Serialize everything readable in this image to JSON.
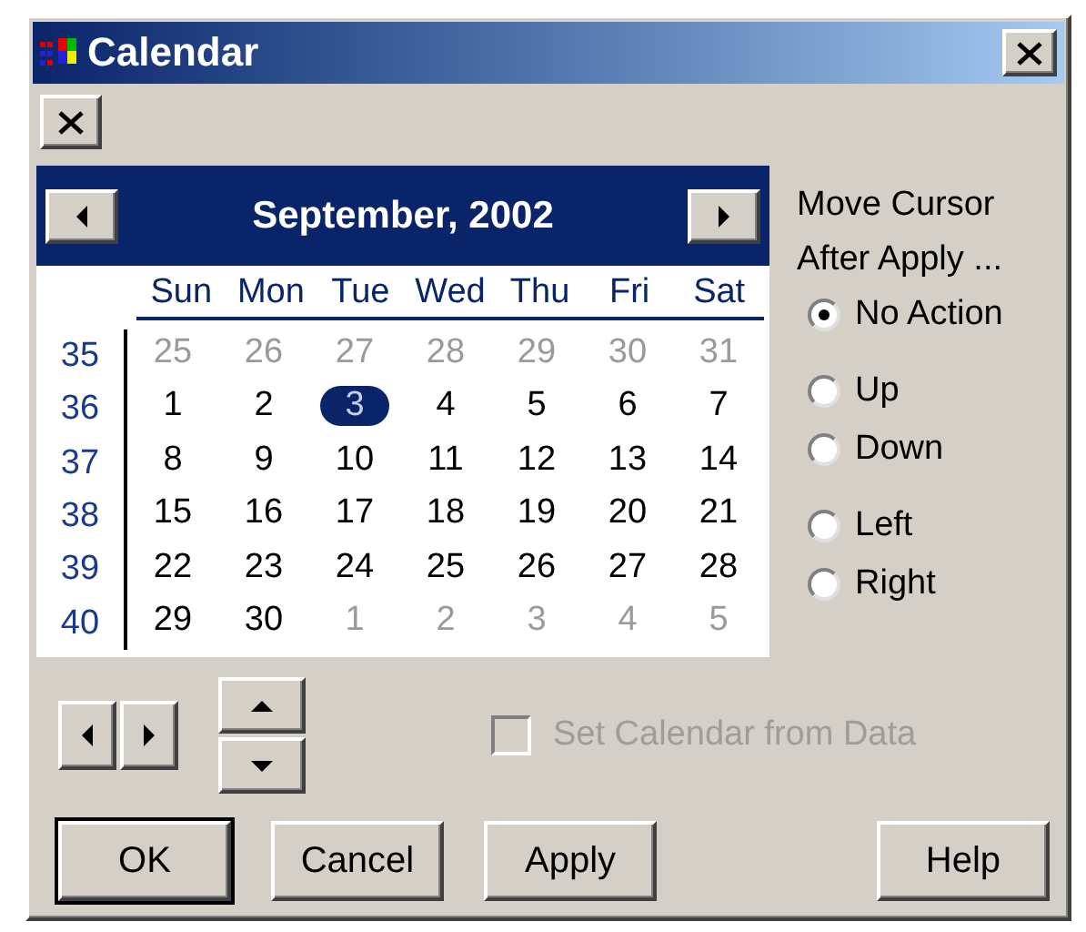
{
  "window": {
    "title": "Calendar"
  },
  "calendar": {
    "month_label": "September, 2002",
    "weekdays": [
      "Sun",
      "Mon",
      "Tue",
      "Wed",
      "Thu",
      "Fri",
      "Sat"
    ],
    "weeks": [
      {
        "number": "35",
        "days": [
          {
            "label": "25",
            "in_month": false,
            "selected": false
          },
          {
            "label": "26",
            "in_month": false,
            "selected": false
          },
          {
            "label": "27",
            "in_month": false,
            "selected": false
          },
          {
            "label": "28",
            "in_month": false,
            "selected": false
          },
          {
            "label": "29",
            "in_month": false,
            "selected": false
          },
          {
            "label": "30",
            "in_month": false,
            "selected": false
          },
          {
            "label": "31",
            "in_month": false,
            "selected": false
          }
        ]
      },
      {
        "number": "36",
        "days": [
          {
            "label": "1",
            "in_month": true,
            "selected": false
          },
          {
            "label": "2",
            "in_month": true,
            "selected": false
          },
          {
            "label": "3",
            "in_month": true,
            "selected": true
          },
          {
            "label": "4",
            "in_month": true,
            "selected": false
          },
          {
            "label": "5",
            "in_month": true,
            "selected": false
          },
          {
            "label": "6",
            "in_month": true,
            "selected": false
          },
          {
            "label": "7",
            "in_month": true,
            "selected": false
          }
        ]
      },
      {
        "number": "37",
        "days": [
          {
            "label": "8",
            "in_month": true,
            "selected": false
          },
          {
            "label": "9",
            "in_month": true,
            "selected": false
          },
          {
            "label": "10",
            "in_month": true,
            "selected": false
          },
          {
            "label": "11",
            "in_month": true,
            "selected": false
          },
          {
            "label": "12",
            "in_month": true,
            "selected": false
          },
          {
            "label": "13",
            "in_month": true,
            "selected": false
          },
          {
            "label": "14",
            "in_month": true,
            "selected": false
          }
        ]
      },
      {
        "number": "38",
        "days": [
          {
            "label": "15",
            "in_month": true,
            "selected": false
          },
          {
            "label": "16",
            "in_month": true,
            "selected": false
          },
          {
            "label": "17",
            "in_month": true,
            "selected": false
          },
          {
            "label": "18",
            "in_month": true,
            "selected": false
          },
          {
            "label": "19",
            "in_month": true,
            "selected": false
          },
          {
            "label": "20",
            "in_month": true,
            "selected": false
          },
          {
            "label": "21",
            "in_month": true,
            "selected": false
          }
        ]
      },
      {
        "number": "39",
        "days": [
          {
            "label": "22",
            "in_month": true,
            "selected": false
          },
          {
            "label": "23",
            "in_month": true,
            "selected": false
          },
          {
            "label": "24",
            "in_month": true,
            "selected": false
          },
          {
            "label": "25",
            "in_month": true,
            "selected": false
          },
          {
            "label": "26",
            "in_month": true,
            "selected": false
          },
          {
            "label": "27",
            "in_month": true,
            "selected": false
          },
          {
            "label": "28",
            "in_month": true,
            "selected": false
          }
        ]
      },
      {
        "number": "40",
        "days": [
          {
            "label": "29",
            "in_month": true,
            "selected": false
          },
          {
            "label": "30",
            "in_month": true,
            "selected": false
          },
          {
            "label": "1",
            "in_month": false,
            "selected": false
          },
          {
            "label": "2",
            "in_month": false,
            "selected": false
          },
          {
            "label": "3",
            "in_month": false,
            "selected": false
          },
          {
            "label": "4",
            "in_month": false,
            "selected": false
          },
          {
            "label": "5",
            "in_month": false,
            "selected": false
          }
        ]
      }
    ]
  },
  "cursor_options": {
    "label_lines": [
      "Move Cursor",
      "After Apply ..."
    ],
    "groups": [
      [
        {
          "label": "No Action",
          "selected": true
        }
      ],
      [
        {
          "label": "Up",
          "selected": false
        },
        {
          "label": "Down",
          "selected": false
        }
      ],
      [
        {
          "label": "Left",
          "selected": false
        },
        {
          "label": "Right",
          "selected": false
        }
      ]
    ]
  },
  "set_from_data": {
    "label": "Set Calendar from Data",
    "checked": false,
    "disabled": true
  },
  "buttons": [
    {
      "label": "OK",
      "default": true
    },
    {
      "label": "Cancel",
      "default": false
    },
    {
      "label": "Apply",
      "default": false
    },
    {
      "label": "Help",
      "default": false
    }
  ]
}
